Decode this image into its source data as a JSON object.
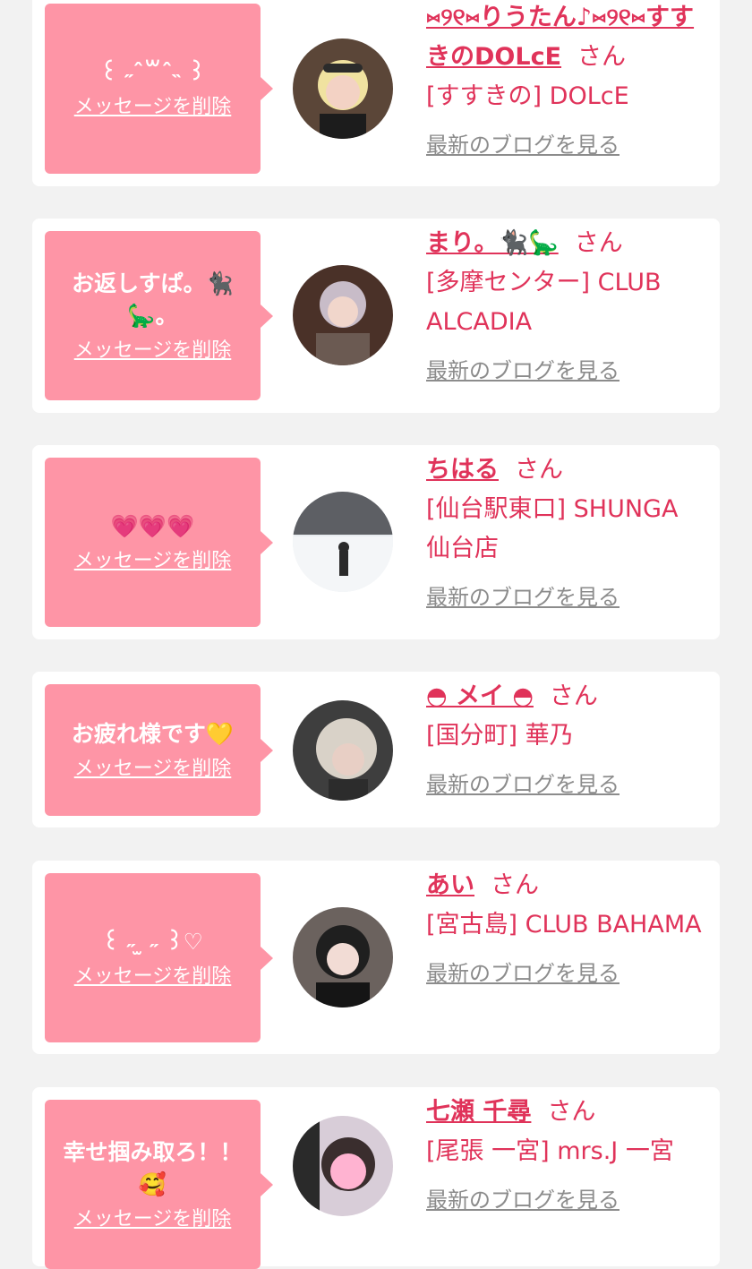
{
  "delete_label": "メッセージを削除",
  "san_label": "さん",
  "blog_label": "最新のブログを見る",
  "colors": {
    "bubble": "#fe95a6",
    "accent": "#e0335a",
    "link_gray": "#8c8c8c",
    "background": "#f2f2f2"
  },
  "messages": [
    {
      "message": "꒰ ˶ˆ꒳ˆ˵ ꒱",
      "name": "⑅୨୧⑅りうたん♪⑅୨୧⑅すすきのDOLcE",
      "shop": "[すすきの] DOLcE"
    },
    {
      "message": "お返しすぱ。🐈‍⬛🦕。",
      "name": "まり。🐈‍⬛🦕",
      "shop": "[多摩センター] CLUB ALCADIA"
    },
    {
      "message": "💗💗💗",
      "name": "ちはる",
      "shop": "[仙台駅東口] SHUNGA 仙台店"
    },
    {
      "message": "お疲れ様です💛",
      "name": "◓ メイ ◓",
      "shop": "[国分町] 華乃"
    },
    {
      "message": "꒰ ˶ ̫ ˶ ꒱♡",
      "name": "あい",
      "shop": "[宮古島] CLUB BAHAMA"
    },
    {
      "message": "幸せ掴み取ろ！！🥰",
      "name": "七瀬 千尋",
      "shop": "[尾張 一宮] mrs.J 一宮"
    }
  ]
}
